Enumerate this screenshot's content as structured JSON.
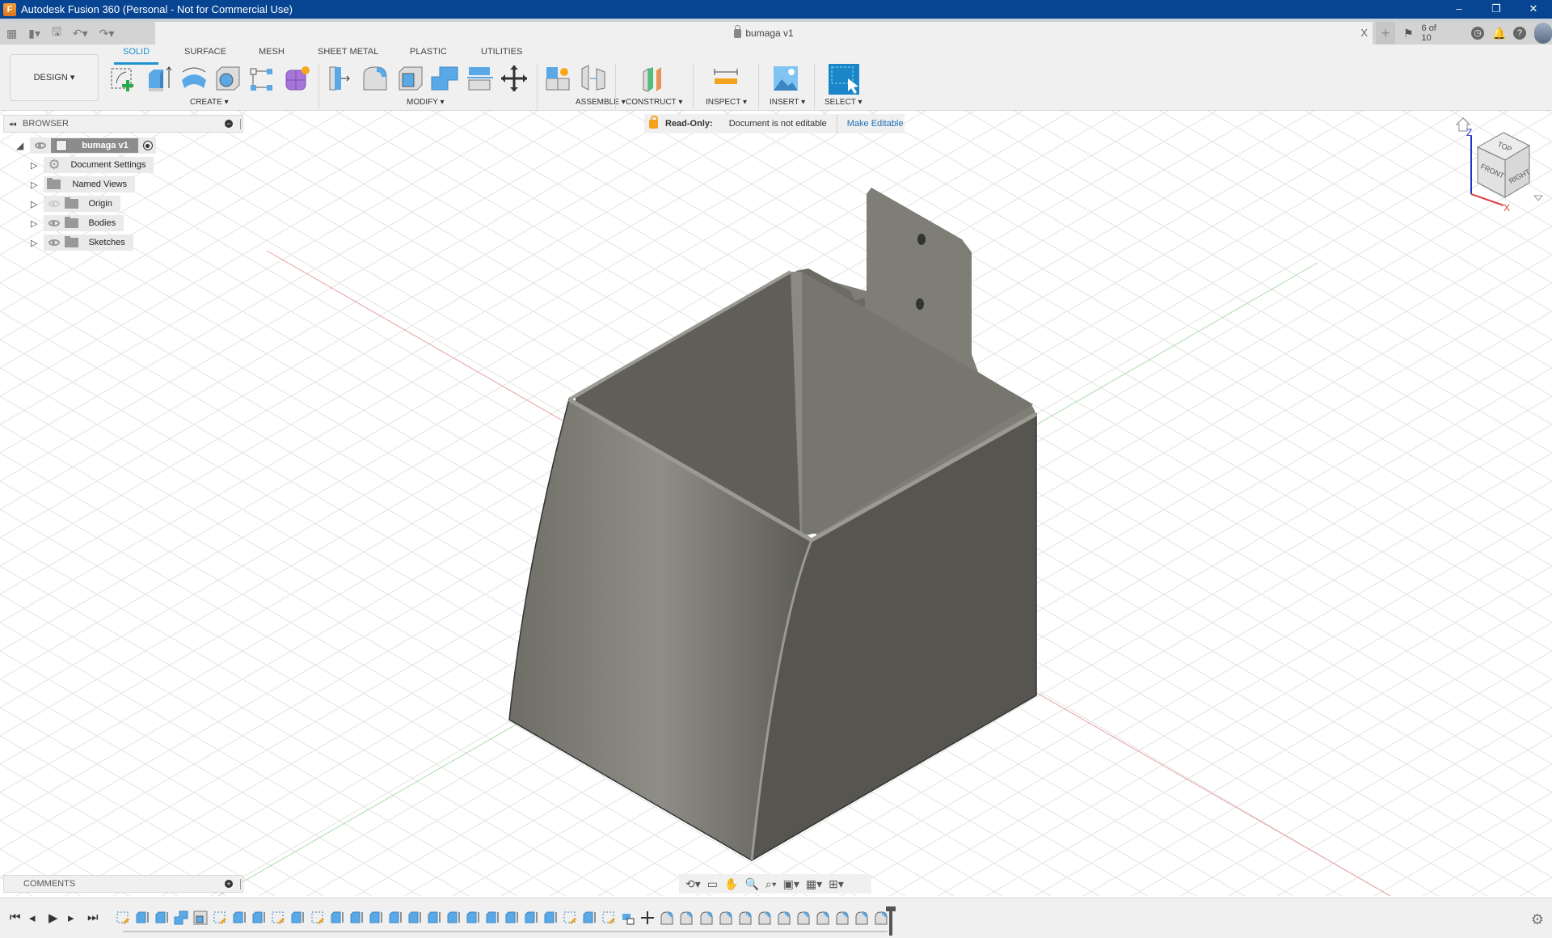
{
  "window": {
    "title": "Autodesk Fusion 360 (Personal - Not for Commercial Use)",
    "controls": [
      "minimize",
      "restore",
      "close"
    ]
  },
  "quick_access": {
    "icons": [
      "app-grid-icon",
      "file-icon",
      "save-icon",
      "undo-icon",
      "redo-icon"
    ]
  },
  "document_tab": {
    "name": "bumaga v1",
    "locked": true,
    "close_label": "X"
  },
  "right_toolbar": {
    "new_tab_label": "+",
    "job_status": "6 of 10",
    "icons": [
      "job-status-icon",
      "clock-icon",
      "notifications-icon",
      "help-icon",
      "user-avatar"
    ]
  },
  "ribbon": {
    "workspace_label": "DESIGN ▾",
    "tabs": [
      {
        "label": "SOLID",
        "active": true
      },
      {
        "label": "SURFACE",
        "active": false
      },
      {
        "label": "MESH",
        "active": false
      },
      {
        "label": "SHEET METAL",
        "active": false
      },
      {
        "label": "PLASTIC",
        "active": false
      },
      {
        "label": "UTILITIES",
        "active": false
      }
    ],
    "groups": [
      {
        "label": "CREATE ▾",
        "tools": [
          "create-sketch",
          "extrude",
          "revolve",
          "hole",
          "pattern",
          "create-form"
        ]
      },
      {
        "label": "MODIFY ▾",
        "tools": [
          "press-pull",
          "fillet",
          "shell",
          "combine",
          "offset-face",
          "move-copy"
        ]
      },
      {
        "label": "ASSEMBLE ▾",
        "tools": [
          "new-component",
          "joint"
        ]
      },
      {
        "label": "CONSTRUCT ▾",
        "tools": [
          "offset-plane"
        ]
      },
      {
        "label": "INSPECT ▾",
        "tools": [
          "measure"
        ]
      },
      {
        "label": "INSERT ▾",
        "tools": [
          "insert-image"
        ]
      },
      {
        "label": "SELECT ▾",
        "tools": [
          "select"
        ]
      }
    ],
    "accent": "#1d93cf"
  },
  "browser": {
    "title": "BROWSER",
    "root": {
      "label": "bumaga v1"
    },
    "items": [
      {
        "label": "Document Settings",
        "icon": "gear-icon",
        "visibility": null
      },
      {
        "label": "Named Views",
        "icon": "folder-icon",
        "visibility": null
      },
      {
        "label": "Origin",
        "icon": "folder-icon",
        "visibility": "hidden"
      },
      {
        "label": "Bodies",
        "icon": "folder-icon",
        "visibility": "visible"
      },
      {
        "label": "Sketches",
        "icon": "folder-icon",
        "visibility": "visible"
      }
    ]
  },
  "read_only_banner": {
    "label": "Read-Only:",
    "message": "Document is not editable",
    "action": "Make Editable"
  },
  "viewcube": {
    "faces": [
      "TOP",
      "FRONT",
      "RIGHT"
    ],
    "axes": [
      "Z",
      "X"
    ]
  },
  "comments": {
    "title": "COMMENTS"
  },
  "nav_bar": {
    "icons": [
      "orbit-icon",
      "look-at-icon",
      "pan-icon",
      "zoom-icon",
      "fit-icon",
      "display-settings-icon",
      "grid-icon",
      "viewports-icon"
    ]
  },
  "timeline": {
    "playback": [
      "first",
      "previous",
      "play",
      "next",
      "last"
    ],
    "features": [
      "sketch",
      "extrude",
      "extrude",
      "combine",
      "shell",
      "sketch",
      "extrude",
      "extrude",
      "sketch",
      "extrude",
      "sketch",
      "extrude",
      "extrude",
      "extrude",
      "extrude",
      "extrude",
      "extrude",
      "extrude",
      "extrude",
      "extrude",
      "extrude",
      "extrude",
      "extrude",
      "sketch",
      "extrude",
      "sketch",
      "move-copy",
      "move",
      "fillet",
      "fillet",
      "fillet",
      "fillet",
      "fillet",
      "fillet",
      "fillet",
      "fillet",
      "fillet",
      "fillet",
      "fillet",
      "fillet"
    ]
  }
}
